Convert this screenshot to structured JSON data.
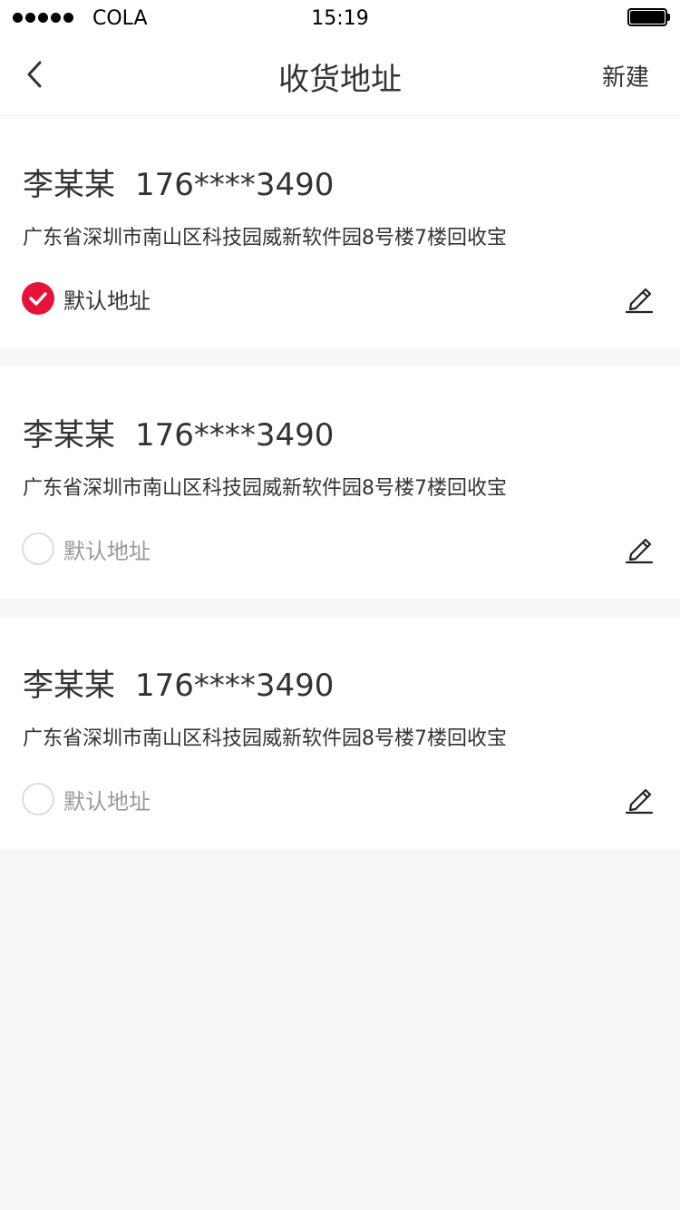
{
  "status_bar": {
    "carrier": "COLA",
    "time": "15:19",
    "signal_icon": "signal-dots-icon",
    "battery_icon": "battery-full-icon"
  },
  "nav": {
    "title": "收货地址",
    "action_label": "新建",
    "back_icon": "chevron-left-icon"
  },
  "colors": {
    "accent": "#e5133a",
    "text_primary": "#333333",
    "text_muted": "#999999",
    "background": "#f6f7f9"
  },
  "addresses": [
    {
      "name": "李某某",
      "phone": "176****3490",
      "address": "广东省深圳市南山区科技园威新软件园8号楼7楼回收宝",
      "default_label": "默认地址",
      "is_default": true
    },
    {
      "name": "李某某",
      "phone": "176****3490",
      "address": "广东省深圳市南山区科技园威新软件园8号楼7楼回收宝",
      "default_label": "默认地址",
      "is_default": false
    },
    {
      "name": "李某某",
      "phone": "176****3490",
      "address": "广东省深圳市南山区科技园威新软件园8号楼7楼回收宝",
      "default_label": "默认地址",
      "is_default": false
    }
  ]
}
